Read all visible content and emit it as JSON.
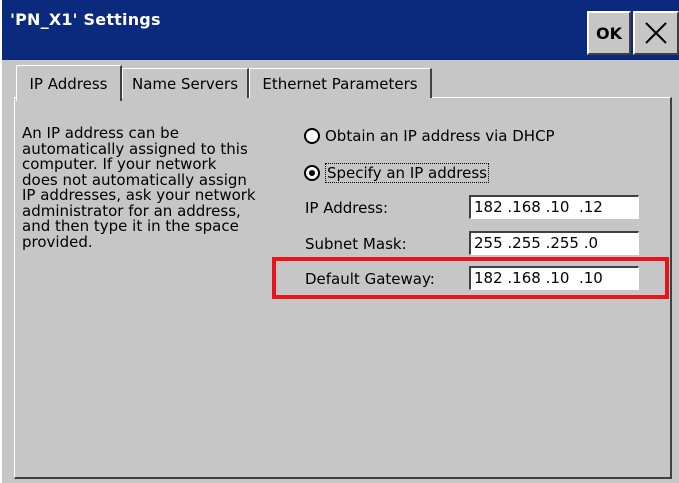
{
  "window": {
    "title": "'PN_X1' Settings",
    "ok_label": "OK",
    "close_icon": "close-x-icon",
    "colors": {
      "titlebar": "#0b2a7e",
      "face": "#c6c6c6",
      "highlight": "#e8141c"
    }
  },
  "tabs": [
    {
      "label": "IP Address",
      "active": true
    },
    {
      "label": "Name Servers",
      "active": false
    },
    {
      "label": "Ethernet Parameters",
      "active": false
    }
  ],
  "description": "An IP address can be\nautomatically assigned to this\ncomputer.  If your network\ndoes not automatically assign\nIP addresses, ask your network\nadministrator for an address,\nand then type it in the space\nprovided.",
  "options": {
    "dhcp_label": "Obtain an IP address via DHCP",
    "specify_label": "Specify an IP address",
    "selected": "specify"
  },
  "fields": {
    "ip_address": {
      "label": "IP Address:",
      "value": "182 .168 .10  .12"
    },
    "subnet_mask": {
      "label": "Subnet Mask:",
      "value": "255 .255 .255 .0"
    },
    "default_gateway": {
      "label": "Default Gateway:",
      "value": "182 .168 .10  .10"
    }
  }
}
